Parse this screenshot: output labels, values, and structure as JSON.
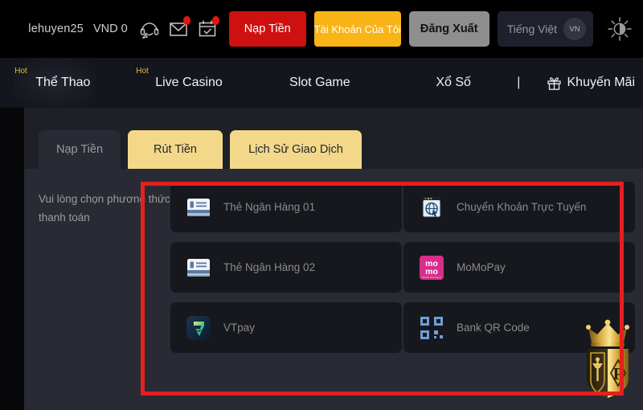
{
  "header": {
    "username": "lehuyen25",
    "balance": "VND 0",
    "icons": [
      {
        "name": "headset-support-icon",
        "badge": false
      },
      {
        "name": "mail-icon",
        "badge": true
      },
      {
        "name": "calendar-check-icon",
        "badge": true
      }
    ],
    "deposit_label": "Nạp Tiền",
    "account_label": "Tài Khoản Của Tôi",
    "logout_label": "Đăng Xuất",
    "language_label": "Tiếng Việt",
    "language_code": "VN",
    "brightness_icon": "sun-brightness-icon"
  },
  "nav": {
    "items": [
      {
        "label": "Thể Thao",
        "hot": "Hot",
        "active": true
      },
      {
        "label": "Live Casino",
        "hot": "Hot",
        "active": false
      },
      {
        "label": "Slot Game",
        "hot": "",
        "active": false
      },
      {
        "label": "Xổ Số",
        "hot": "",
        "active": false
      }
    ],
    "separator": "|",
    "promo_label": "Khuyến Mãi",
    "promo_icon": "gift-icon"
  },
  "tabs": [
    {
      "label": "Nạp Tiền",
      "active": true
    },
    {
      "label": "Rút Tiền",
      "active": false
    },
    {
      "label": "Lịch Sử Giao Dịch",
      "active": false
    }
  ],
  "panel": {
    "hint": "Vui lòng chọn phương thức thanh toán",
    "methods": [
      {
        "label": "Thẻ Ngân Hàng 01",
        "icon": "bank-card-icon"
      },
      {
        "label": "Chuyển Khoản Trực Tuyến",
        "icon": "online-transfer-globe-icon"
      },
      {
        "label": "Thẻ Ngân Hàng 02",
        "icon": "bank-card-icon"
      },
      {
        "label": "MoMoPay",
        "icon": "momo-logo-icon"
      },
      {
        "label": "VTpay",
        "icon": "vtpay-logo-icon"
      },
      {
        "label": "Bank QR Code",
        "icon": "qr-code-icon"
      }
    ]
  },
  "watermark": {
    "icon": "crown-shield-logo"
  },
  "colors": {
    "accent_red": "#cf1010",
    "accent_yellow": "#f9b418",
    "tab_yellow": "#f4d889",
    "annotation_red": "#e51f1f",
    "panel_bg": "#282b33",
    "card_bg": "#16181e",
    "nav_bg": "#14161d"
  }
}
